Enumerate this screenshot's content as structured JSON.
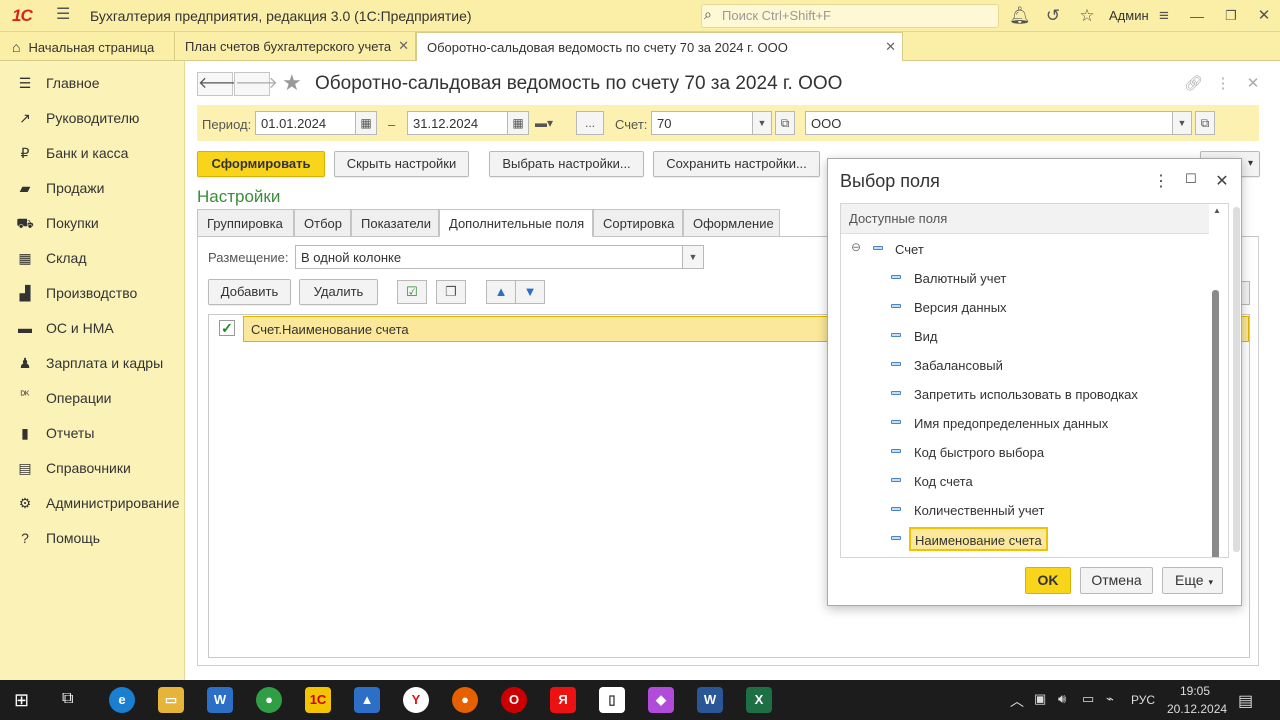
{
  "app": {
    "logo": "1С",
    "title": "Бухгалтерия предприятия, редакция 3.0  (1С:Предприятие)",
    "search_placeholder": "Поиск Ctrl+Shift+F",
    "user": "Админ"
  },
  "tabs": [
    {
      "label": "Начальная страница"
    },
    {
      "label": "План счетов бухгалтерского учета"
    },
    {
      "label": "Оборотно-сальдовая ведомость по счету 70 за 2024 г. ООО"
    }
  ],
  "sidebar": {
    "items": [
      {
        "label": "Главное",
        "icon": "☰"
      },
      {
        "label": "Руководителю",
        "icon": "↗"
      },
      {
        "label": "Банк и касса",
        "icon": "₽"
      },
      {
        "label": "Продажи",
        "icon": "▰"
      },
      {
        "label": "Покупки",
        "icon": "⛟"
      },
      {
        "label": "Склад",
        "icon": "▦"
      },
      {
        "label": "Производство",
        "icon": "▟"
      },
      {
        "label": "ОС и НМА",
        "icon": "▬"
      },
      {
        "label": "Зарплата и кадры",
        "icon": "♟"
      },
      {
        "label": "Операции",
        "icon": "ᴰᴷ"
      },
      {
        "label": "Отчеты",
        "icon": "▮"
      },
      {
        "label": "Справочники",
        "icon": "▤"
      },
      {
        "label": "Администрирование",
        "icon": "⚙"
      },
      {
        "label": "Помощь",
        "icon": "?"
      }
    ]
  },
  "document": {
    "title": "Оборотно-сальдовая ведомость по счету 70 за 2024 г. ООО"
  },
  "filter": {
    "period_label": "Период:",
    "date_from": "01.01.2024",
    "dash": "–",
    "date_to": "31.12.2024",
    "dots": "...",
    "account_label": "Счет:",
    "account": "70",
    "org": "ООО"
  },
  "toolbar": {
    "generate": "Сформировать",
    "hide_settings": "Скрыть настройки",
    "choose_settings": "Выбрать настройки...",
    "save_settings": "Сохранить настройки..."
  },
  "settings": {
    "header": "Настройки",
    "tabs": [
      "Группировка",
      "Отбор",
      "Показатели",
      "Дополнительные поля",
      "Сортировка",
      "Оформление"
    ],
    "placement_label": "Размещение:",
    "placement_value": "В одной колонке",
    "add": "Добавить",
    "delete": "Удалить",
    "field_row": "Счет.Наименование счета"
  },
  "dialog": {
    "title": "Выбор поля",
    "tree_header": "Доступные поля",
    "root": "Счет",
    "items": [
      "Валютный учет",
      "Версия данных",
      "Вид",
      "Забалансовый",
      "Запретить использовать в проводках",
      "Имя предопределенных данных",
      "Код быстрого выбора",
      "Код счета",
      "Количественный учет",
      "Наименование счета"
    ],
    "selected": "Наименование счета",
    "ok": "OK",
    "cancel": "Отмена",
    "more": "Еще"
  },
  "taskbar": {
    "lang": "РУС",
    "time": "19:05",
    "date": "20.12.2024"
  },
  "colors": {
    "accent_yellow": "#f8d41a",
    "panel_yellow": "#fbf2b8",
    "header_green": "#3a8d3a"
  }
}
